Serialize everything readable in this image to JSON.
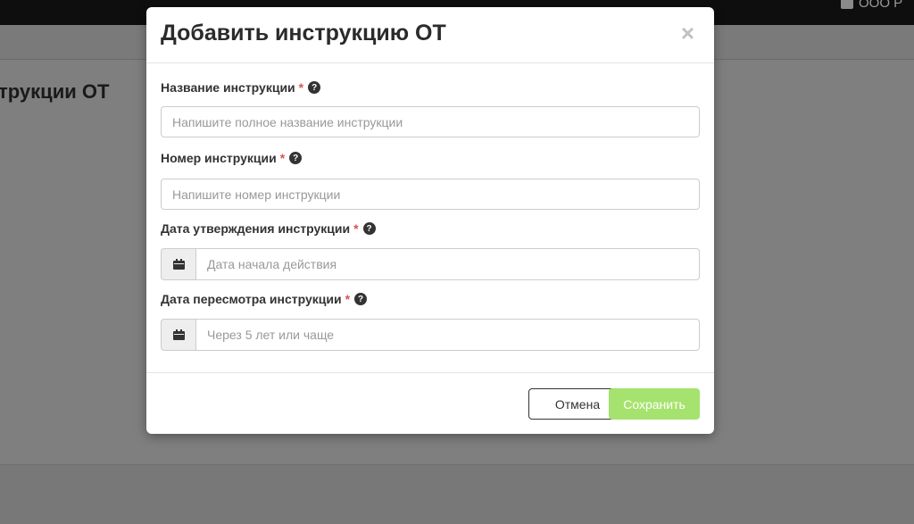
{
  "background": {
    "page_title": "трукции ОТ",
    "user_label": "ООО Р"
  },
  "modal": {
    "title": "Добавить инструкцию ОТ",
    "close_symbol": "×",
    "fields": [
      {
        "label": "Название инструкции",
        "required_mark": "*",
        "help": "?",
        "placeholder": "Напишите полное название инструкции"
      },
      {
        "label": "Номер инструкции",
        "required_mark": "*",
        "help": "?",
        "placeholder": "Напишите номер инструкции"
      },
      {
        "label": "Дата утверждения инструкции",
        "required_mark": "*",
        "help": "?",
        "placeholder": "Дата начала действия",
        "icon": "calendar-icon"
      },
      {
        "label": "Дата пересмотра инструкции",
        "required_mark": "*",
        "help": "?",
        "placeholder": "Через 5 лет или чаще",
        "icon": "calendar-icon"
      }
    ],
    "cancel_label": "Отмена",
    "save_label": "Сохранить"
  },
  "colors": {
    "required": "#d9534f",
    "save_button": "#a6e36e",
    "overlay": "#7f7f7f"
  }
}
